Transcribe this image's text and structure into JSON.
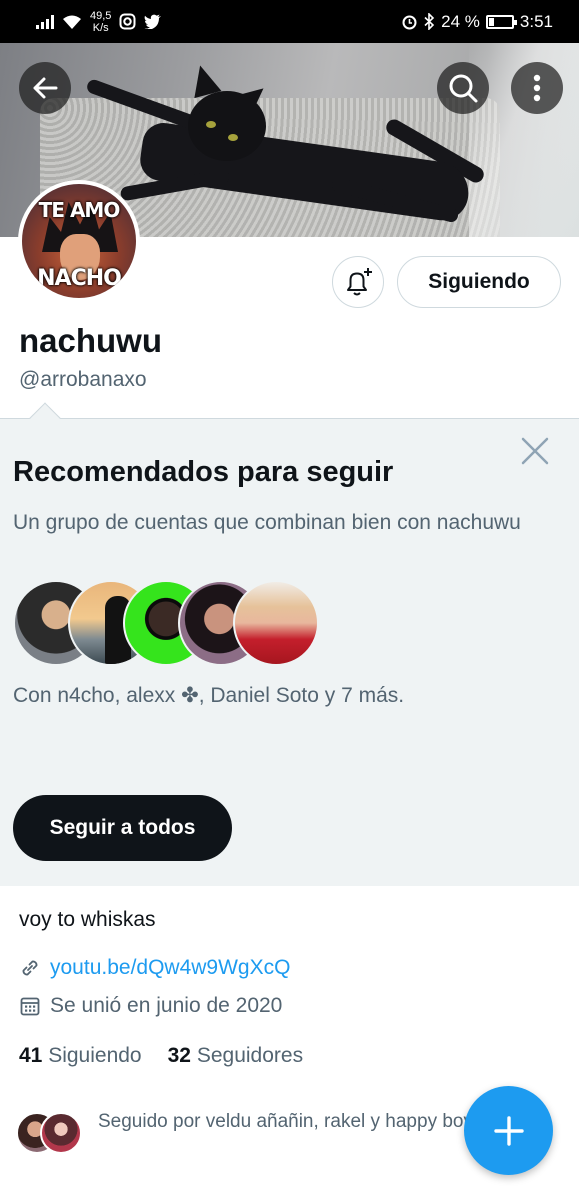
{
  "status_bar": {
    "net_speed_value": "49,5",
    "net_speed_unit": "K/s",
    "battery": "24 %",
    "battery_level": 0.24,
    "time": "3:51"
  },
  "header": {
    "back_icon": "arrow-left-icon",
    "search_icon": "search-icon",
    "more_icon": "more-vertical-icon"
  },
  "avatar": {
    "line1": "TE AMO",
    "line2": "NACHO"
  },
  "actions": {
    "notify_icon": "bell-plus-icon",
    "following_label": "Siguiendo"
  },
  "profile": {
    "display_name": "nachuwu",
    "handle": "@arrobanaxo",
    "bio": "voy to whiskas",
    "link": "youtu.be/dQw4w9WgXcQ",
    "joined": "Se unió en junio de 2020",
    "following_count": "41",
    "following_label": "Siguiendo",
    "followers_count": "32",
    "followers_label": "Seguidores"
  },
  "recommendations": {
    "title": "Recomendados para seguir",
    "subtitle": "Un grupo de cuentas que combinan bien con nachuwu",
    "with_text": "Con n4cho, alexx ✤, Daniel Soto y 7 más.",
    "follow_all_label": "Seguir a todos"
  },
  "followed_by": {
    "text": "Seguido por veldu añañin, rakel y happy boy"
  },
  "colors": {
    "accent": "#1d9bf0",
    "text": "#0f1419",
    "secondary": "#536471",
    "panel": "#eff3f4"
  }
}
